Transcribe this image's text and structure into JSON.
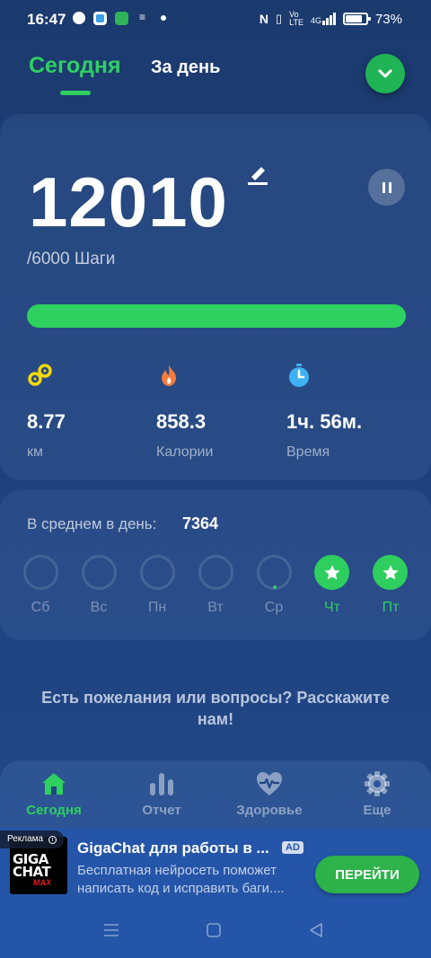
{
  "status_bar": {
    "time": "16:47",
    "battery": "73%",
    "signal_text": "4G"
  },
  "tabs": {
    "today": "Сегодня",
    "day": "За день"
  },
  "steps": {
    "value": "12010",
    "goal": "/6000 Шаги",
    "progress_fraction": 1.0
  },
  "stats": [
    {
      "icon": "distance-icon",
      "value": "8.77",
      "label": "км",
      "color": "#f5d90a"
    },
    {
      "icon": "flame-icon",
      "value": "858.3",
      "label": "Калории",
      "color": "#f47c3c"
    },
    {
      "icon": "stopwatch-icon",
      "value": "1ч. 56м.",
      "label": "Время",
      "color": "#3fb1f2"
    }
  ],
  "average": {
    "label": "В среднем в день:",
    "value": "7364"
  },
  "week": [
    {
      "label": "Сб",
      "done": false
    },
    {
      "label": "Вс",
      "done": false
    },
    {
      "label": "Пн",
      "done": false
    },
    {
      "label": "Вт",
      "done": false
    },
    {
      "label": "Ср",
      "done": false
    },
    {
      "label": "Чт",
      "done": true
    },
    {
      "label": "Пт",
      "done": true
    }
  ],
  "feedback": "Есть пожелания или вопросы? Расскажите нам!",
  "bottom_nav": [
    {
      "label": "Сегодня",
      "icon": "home-icon",
      "active": true
    },
    {
      "label": "Отчет",
      "icon": "bar-chart-icon",
      "active": false
    },
    {
      "label": "Здоровье",
      "icon": "heart-pulse-icon",
      "active": false
    },
    {
      "label": "Еще",
      "icon": "gear-icon",
      "active": false
    }
  ],
  "ad": {
    "badge": "Реклама",
    "logo_line1": "GIGA",
    "logo_line2": "CHAT",
    "logo_line3": "MAX",
    "title": "GigaChat для работы в ...",
    "tag": "AD",
    "description": "Бесплатная нейросеть поможет написать код и исправить баги....",
    "button": "ПЕРЕЙТИ"
  },
  "colors": {
    "accent": "#2ed05f",
    "background": "#1e3f78"
  }
}
